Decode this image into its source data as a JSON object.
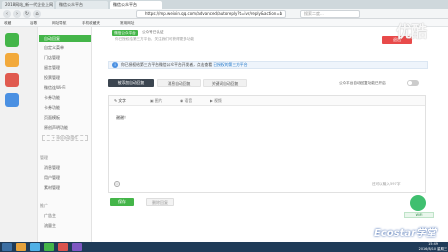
{
  "browser": {
    "tabs": [
      "2018网站_新一代企业上网",
      "微信公众平台",
      "微信公众平台"
    ],
    "url": "https://mp.weixin.qq.com/advanced/autoreply?t=ivr/reply&action=b",
    "search_placeholder": "搜索二度..."
  },
  "bookmarks": [
    "收藏",
    "谷歌",
    "网址导航",
    "手机收藏夹",
    "常用网址"
  ],
  "sidebar": {
    "active_item": "自动回复",
    "items": [
      "自定义菜单",
      "门店管理",
      "留言管理",
      "投票管理",
      "微信连Wi-Fi",
      "卡券功能",
      "卡券功能",
      "页面模板",
      "原创声明功能"
    ],
    "add_plugin": "+ 添加功能插件",
    "section_manage": "管理",
    "manage_items": [
      "消息管理",
      "用户管理",
      "素材管理"
    ],
    "section_promo": "推广",
    "promo_items": [
      "广告主",
      "流量主"
    ]
  },
  "top_notice": {
    "badge": "微信公众平台",
    "line1": "公众号已认证",
    "line2": "你已授权给第三方平台，关注我们可获得更多功能"
  },
  "logout_label": "退出",
  "info_bar": {
    "text": "你已授权给第三方平台微信公众平台开发者，点击查看",
    "link": "已授权的第三方平台"
  },
  "reply_tabs": [
    "被添加自动回复",
    "消息自动回复",
    "关键词自动回复"
  ],
  "auto_reply_toggle_label": "公众平台自动回复功能已开启",
  "editor": {
    "tools": [
      "文字",
      "图片",
      "语音",
      "视频"
    ],
    "content": "谢谢！",
    "char_count": "还可以输入597字"
  },
  "save_label": "保存",
  "delete_label": "删除回复",
  "watermark_text": "优酷",
  "ecostar_text": "Ecostar学堂",
  "wifi_label": "WiFi",
  "clock": {
    "time": "15:49",
    "date": "2016/8/10 星期三"
  },
  "colors": {
    "primary_green": "#44b549",
    "logout_red": "#e84a4a",
    "dark_tab": "#3b4550"
  }
}
